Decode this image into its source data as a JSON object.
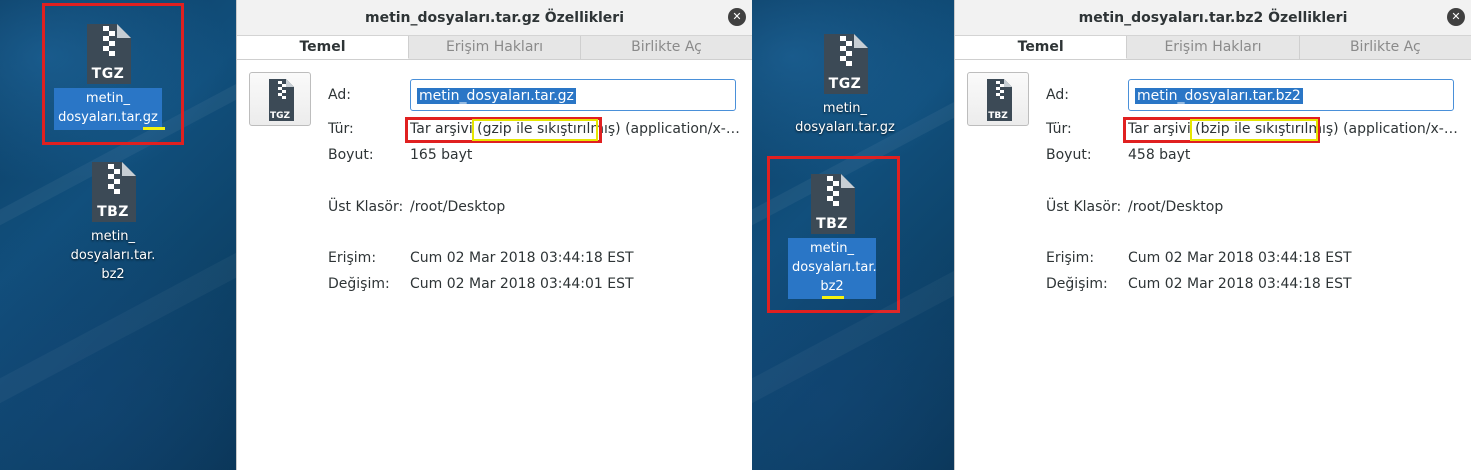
{
  "desktop_left": {
    "icons": [
      {
        "ext": "TGZ",
        "lines": [
          "metin_",
          "dosyaları.tar.gz"
        ],
        "selected": true
      },
      {
        "ext": "TBZ",
        "lines": [
          "metin_",
          "dosyaları.tar.",
          "bz2"
        ],
        "selected": false
      }
    ]
  },
  "desktop_mid": {
    "icons": [
      {
        "ext": "TGZ",
        "lines": [
          "metin_",
          "dosyaları.tar.gz"
        ],
        "selected": false
      },
      {
        "ext": "TBZ",
        "lines": [
          "metin_",
          "dosyaları.tar.",
          "bz2"
        ],
        "selected": true
      }
    ]
  },
  "dialog_gz": {
    "title": "metin_dosyaları.tar.gz Özellikleri",
    "close_glyph": "✕",
    "tabs": [
      "Temel",
      "Erişim Hakları",
      "Birlikte Aç"
    ],
    "icon_ext": "TGZ",
    "labels": {
      "name": "Ad:",
      "type": "Tür:",
      "size": "Boyut:",
      "parent": "Üst Klasör:",
      "accessed": "Erişim:",
      "modified": "Değişim:"
    },
    "name_value": "metin_dosyaları.tar.gz",
    "type_main": "Tar arşivi",
    "type_comp": "(gzip ile sıkıştırılmış)",
    "type_mime": "(application/x-com...",
    "size": "165 bayt",
    "parent": "/root/Desktop",
    "accessed": "Cum 02 Mar 2018 03:44:18 EST",
    "modified": "Cum 02 Mar 2018 03:44:01 EST"
  },
  "dialog_bz2": {
    "title": "metin_dosyaları.tar.bz2 Özellikleri",
    "close_glyph": "✕",
    "tabs": [
      "Temel",
      "Erişim Hakları",
      "Birlikte Aç"
    ],
    "icon_ext": "TBZ",
    "labels": {
      "name": "Ad:",
      "type": "Tür:",
      "size": "Boyut:",
      "parent": "Üst Klasör:",
      "accessed": "Erişim:",
      "modified": "Değişim:"
    },
    "name_value": "metin_dosyaları.tar.bz2",
    "type_main": "Tar arşivi",
    "type_comp": "(bzip ile sıkıştırılmış)",
    "type_mime": "(application/x-bzip-...",
    "size": "458 bayt",
    "parent": "/root/Desktop",
    "accessed": "Cum 02 Mar 2018 03:44:18 EST",
    "modified": "Cum 02 Mar 2018 03:44:18 EST"
  },
  "colors": {
    "highlight_red": "#e02020",
    "highlight_yellow": "#e6e600",
    "selection_blue": "#2a76c6"
  }
}
